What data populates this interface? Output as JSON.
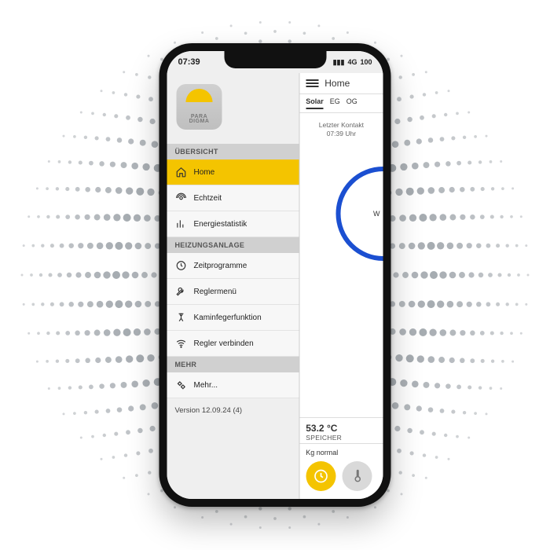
{
  "statusbar": {
    "time": "07:39",
    "network": "4G",
    "battery": "100"
  },
  "brand": {
    "line1": "PARA",
    "line2": "DIGMA"
  },
  "sections": {
    "overview": "ÜBERSICHT",
    "heating": "HEIZUNGSANLAGE",
    "more": "MEHR"
  },
  "nav": {
    "home": "Home",
    "realtime": "Echtzeit",
    "energy": "Energiestatistik",
    "schedules": "Zeitprogramme",
    "regler": "Reglermenü",
    "kaminfeger": "Kaminfegerfunktion",
    "connect": "Regler verbinden",
    "more": "Mehr..."
  },
  "version": "Version 12.09.24 (4)",
  "main": {
    "title": "Home",
    "tabs": {
      "solar": "Solar",
      "eg": "EG",
      "og": "OG"
    },
    "lastContactLabel": "Letzter Kontakt",
    "lastContactTime": "07:39 Uhr",
    "gaugeLetter": "W",
    "temp": "53.2 °C",
    "tempLabel": "SPEICHER",
    "kg": "Kg normal"
  }
}
